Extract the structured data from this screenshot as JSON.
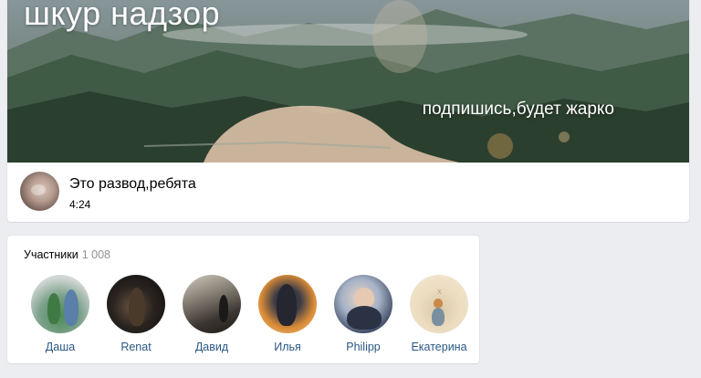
{
  "group": {
    "title": "шкур надзор",
    "tagline": "подпишись,будет жарко",
    "status": "Это развод,ребята",
    "time": "4:24"
  },
  "members": {
    "label": "Участники",
    "count": "1 008",
    "items": [
      {
        "name": "Даша"
      },
      {
        "name": "Renat"
      },
      {
        "name": "Давид"
      },
      {
        "name": "Илья"
      },
      {
        "name": "Philipp"
      },
      {
        "name": "Екатерина"
      }
    ]
  },
  "colors": {
    "background": "#ebedf0",
    "card": "#ffffff",
    "link": "#2a5885",
    "muted": "#939393"
  }
}
